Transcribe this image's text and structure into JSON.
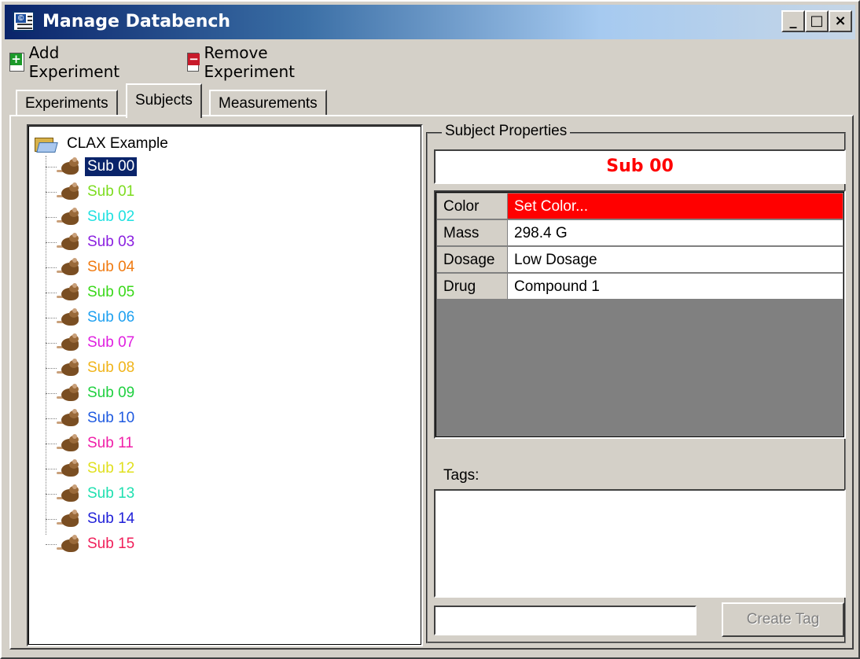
{
  "window": {
    "title": "Manage Databench",
    "controls": {
      "minimize": "_",
      "maximize": "□",
      "close": "×"
    }
  },
  "toolbar": {
    "add_label": "Add Experiment",
    "remove_label": "Remove Experiment",
    "add_icon": "add-experiment-icon",
    "remove_icon": "remove-experiment-icon"
  },
  "tabs": [
    {
      "label": "Experiments",
      "active": false
    },
    {
      "label": "Subjects",
      "active": true
    },
    {
      "label": "Measurements",
      "active": false
    }
  ],
  "tree": {
    "root": {
      "label": "CLAX Example",
      "icon": "folder-open-icon"
    },
    "items": [
      {
        "label": "Sub 00",
        "color": "#ffffff",
        "selected": true
      },
      {
        "label": "Sub 01",
        "color": "#7ddc1f"
      },
      {
        "label": "Sub 02",
        "color": "#1fe0e0"
      },
      {
        "label": "Sub 03",
        "color": "#8a1fe0"
      },
      {
        "label": "Sub 04",
        "color": "#f07a10"
      },
      {
        "label": "Sub 05",
        "color": "#3ad81a"
      },
      {
        "label": "Sub 06",
        "color": "#1ea0f0"
      },
      {
        "label": "Sub 07",
        "color": "#e01fe0"
      },
      {
        "label": "Sub 08",
        "color": "#f0b41a"
      },
      {
        "label": "Sub 09",
        "color": "#1fd040"
      },
      {
        "label": "Sub 10",
        "color": "#1f5ae0"
      },
      {
        "label": "Sub 11",
        "color": "#f01fa8"
      },
      {
        "label": "Sub 12",
        "color": "#e0e01f"
      },
      {
        "label": "Sub 13",
        "color": "#1fe0b0"
      },
      {
        "label": "Sub 14",
        "color": "#1f1fd8"
      },
      {
        "label": "Sub 15",
        "color": "#f01f5a"
      }
    ]
  },
  "subject_properties": {
    "legend": "Subject Properties",
    "name": "Sub 00",
    "name_color": "#ff0000",
    "rows": [
      {
        "key": "Color",
        "value": "Set Color...",
        "highlight": "#ff0000"
      },
      {
        "key": "Mass",
        "value": "298.4 G"
      },
      {
        "key": "Dosage",
        "value": "Low Dosage"
      },
      {
        "key": "Drug",
        "value": "Compound 1"
      }
    ],
    "tags_label": "Tags:",
    "tag_input_value": "",
    "create_tag_label": "Create Tag"
  }
}
